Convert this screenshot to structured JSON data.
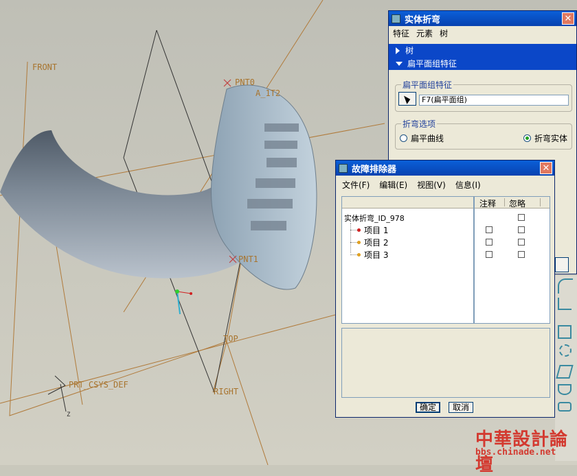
{
  "viewport": {
    "datums": {
      "front": "FRONT",
      "top": "TOP",
      "right": "RIGHT",
      "pnt0": "PNT0",
      "pnt1": "PNT1",
      "axis": "A_1T2",
      "csys": "PRT_CSYS_DEF",
      "csys_z": "Z"
    }
  },
  "solid_bend_dialog": {
    "title": "实体折弯",
    "menus": [
      "特征",
      "元素",
      "树"
    ],
    "tree_rows": [
      {
        "label": "树"
      },
      {
        "label": "扁平面组特征"
      }
    ],
    "quilt_group": {
      "label": "扁平面组特征",
      "value": "F7(扁平面组)"
    },
    "bend_options": {
      "label": "折弯选项",
      "opt1": "扁平曲线",
      "opt2": "折弯实体",
      "selected": "折弯实体"
    }
  },
  "troubleshooter_dialog": {
    "title": "故障排除器",
    "menus": [
      "文件(F)",
      "编辑(E)",
      "视图(V)",
      "信息(I)"
    ],
    "columns": [
      "注释",
      "忽略"
    ],
    "root": "实体折弯_ID_978",
    "items": [
      {
        "label": "项目 1",
        "dot_color": "#d02020"
      },
      {
        "label": "项目 2",
        "dot_color": "#e0a020"
      },
      {
        "label": "项目 3",
        "dot_color": "#e0a020"
      }
    ],
    "ok": "确定",
    "cancel": "取消"
  },
  "watermark": {
    "title": "中華設計論壇",
    "url": "bbs.chinade.net"
  }
}
